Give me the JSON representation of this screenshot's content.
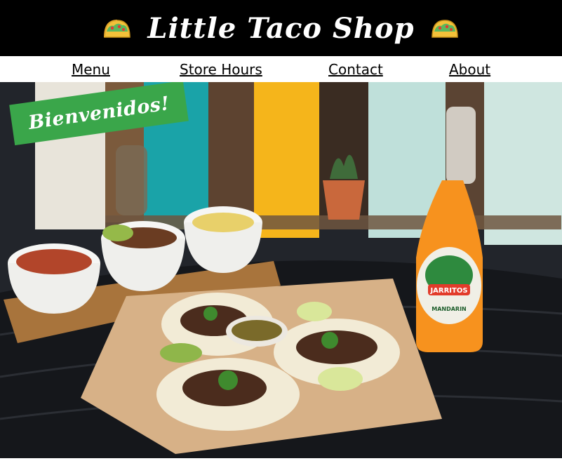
{
  "header": {
    "title": "Little Taco Shop",
    "left_icon": "taco-icon",
    "right_icon": "taco-icon"
  },
  "nav": {
    "items": [
      {
        "label": "Menu"
      },
      {
        "label": "Store Hours"
      },
      {
        "label": "Contact"
      },
      {
        "label": "About"
      }
    ]
  },
  "hero": {
    "banner_text": "Bienvenidos!",
    "image_description": "tacos-with-salsas-and-jarritos",
    "bottle_brand": "JARRITOS",
    "bottle_flavor": "MANDARIN"
  },
  "colors": {
    "header_bg": "#000000",
    "banner_green": "#3aa64a",
    "soda_orange": "#f7921e"
  }
}
